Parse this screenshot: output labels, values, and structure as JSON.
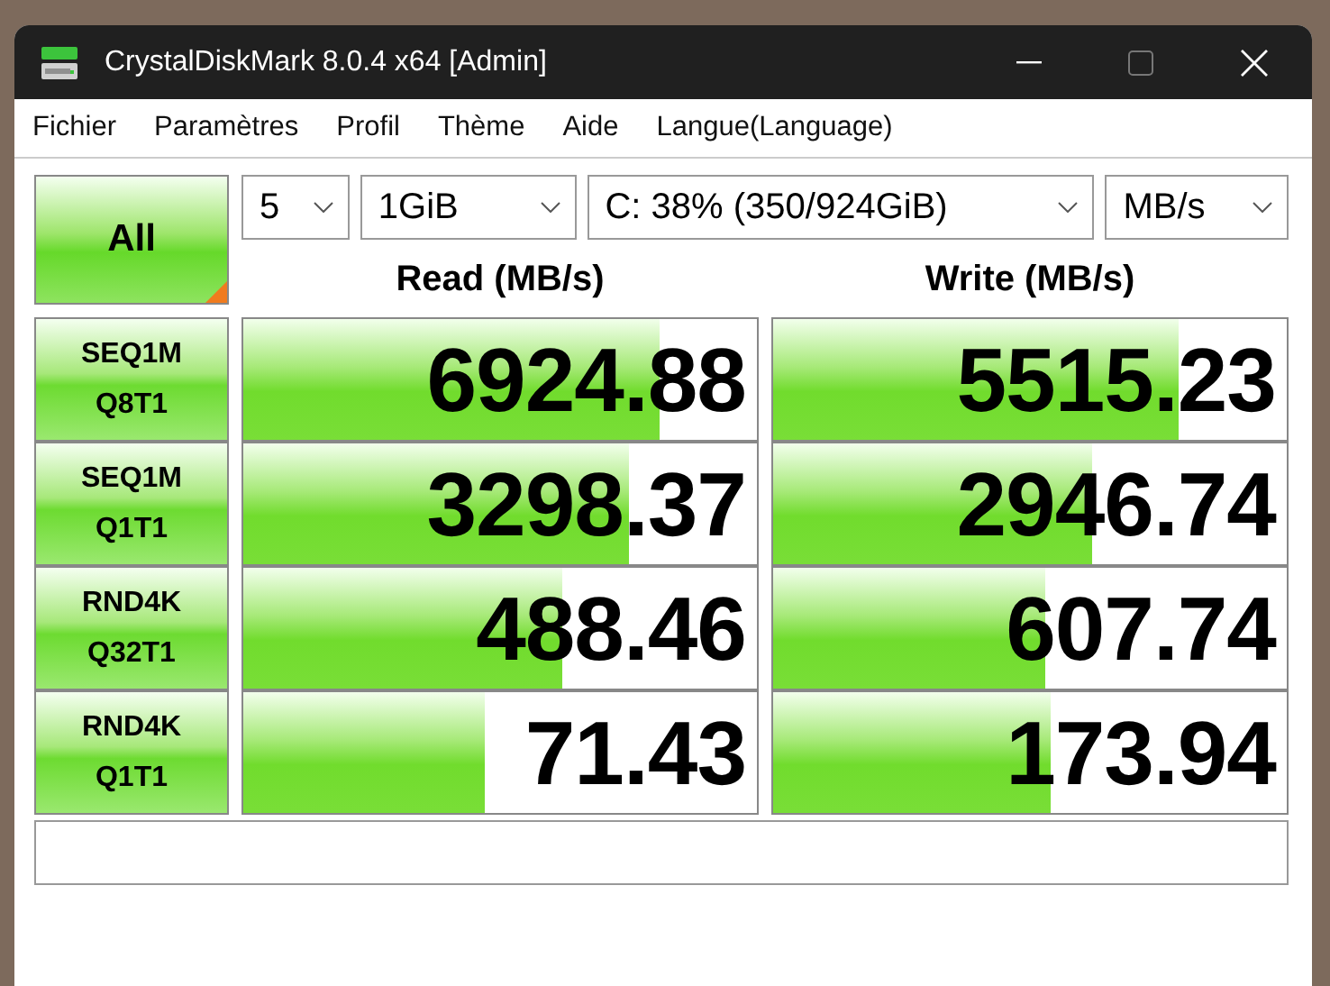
{
  "window": {
    "title": "CrystalDiskMark 8.0.4 x64 [Admin]"
  },
  "menu": [
    "Fichier",
    "Paramètres",
    "Profil",
    "Thème",
    "Aide",
    "Langue(Language)"
  ],
  "all_button": "All",
  "selects": {
    "count": "5",
    "size": "1GiB",
    "drive": "C: 38% (350/924GiB)",
    "unit": "MB/s"
  },
  "columns": [
    "Read (MB/s)",
    "Write (MB/s)"
  ],
  "tests": [
    {
      "label": [
        "SEQ1M",
        "Q8T1"
      ],
      "read": {
        "value": "6924.88",
        "level": 0.81
      },
      "write": {
        "value": "5515.23",
        "level": 0.79
      }
    },
    {
      "label": [
        "SEQ1M",
        "Q1T1"
      ],
      "read": {
        "value": "3298.37",
        "level": 0.75
      },
      "write": {
        "value": "2946.74",
        "level": 0.62
      }
    },
    {
      "label": [
        "RND4K",
        "Q32T1"
      ],
      "read": {
        "value": "488.46",
        "level": 0.62
      },
      "write": {
        "value": "607.74",
        "level": 0.53
      }
    },
    {
      "label": [
        "RND4K",
        "Q1T1"
      ],
      "read": {
        "value": "71.43",
        "level": 0.47
      },
      "write": {
        "value": "173.94",
        "level": 0.54
      }
    }
  ]
}
